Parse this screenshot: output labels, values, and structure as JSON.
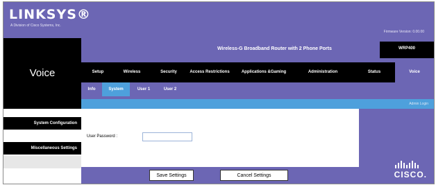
{
  "brand": {
    "logo": "LINKSYS®",
    "subtitle": "A Division of Cisco Systems, Inc."
  },
  "firmware_version": "Firmware Version: 0.00.00",
  "page_title": "Voice",
  "product": {
    "name": "Wireless-G Broadband Router with 2 Phone Ports",
    "model": "WRP400"
  },
  "tabs": [
    {
      "label": "Setup"
    },
    {
      "label": "Wireless"
    },
    {
      "label": "Security"
    },
    {
      "label": "Access Restrictions"
    },
    {
      "label": "Applications &Gaming"
    },
    {
      "label": "Administration"
    },
    {
      "label": "Status"
    },
    {
      "label": "Voice"
    }
  ],
  "active_tab": "Voice",
  "subtabs": [
    {
      "label": "Info"
    },
    {
      "label": "System"
    },
    {
      "label": "User 1"
    },
    {
      "label": "User 2"
    }
  ],
  "active_subtab": "System",
  "admin_link": "Admin Login",
  "sections": [
    {
      "label": "System Configuration"
    },
    {
      "label": "Miscellaneous Settings"
    }
  ],
  "form": {
    "user_password_label": "User Password :",
    "user_password_value": ""
  },
  "buttons": {
    "save": "Save Settings",
    "cancel": "Cancel Settings"
  },
  "footer_logo": "CISCO.",
  "colors": {
    "purple": "#6c66b4",
    "blue_active": "#4ea0dc",
    "black": "#000000"
  }
}
